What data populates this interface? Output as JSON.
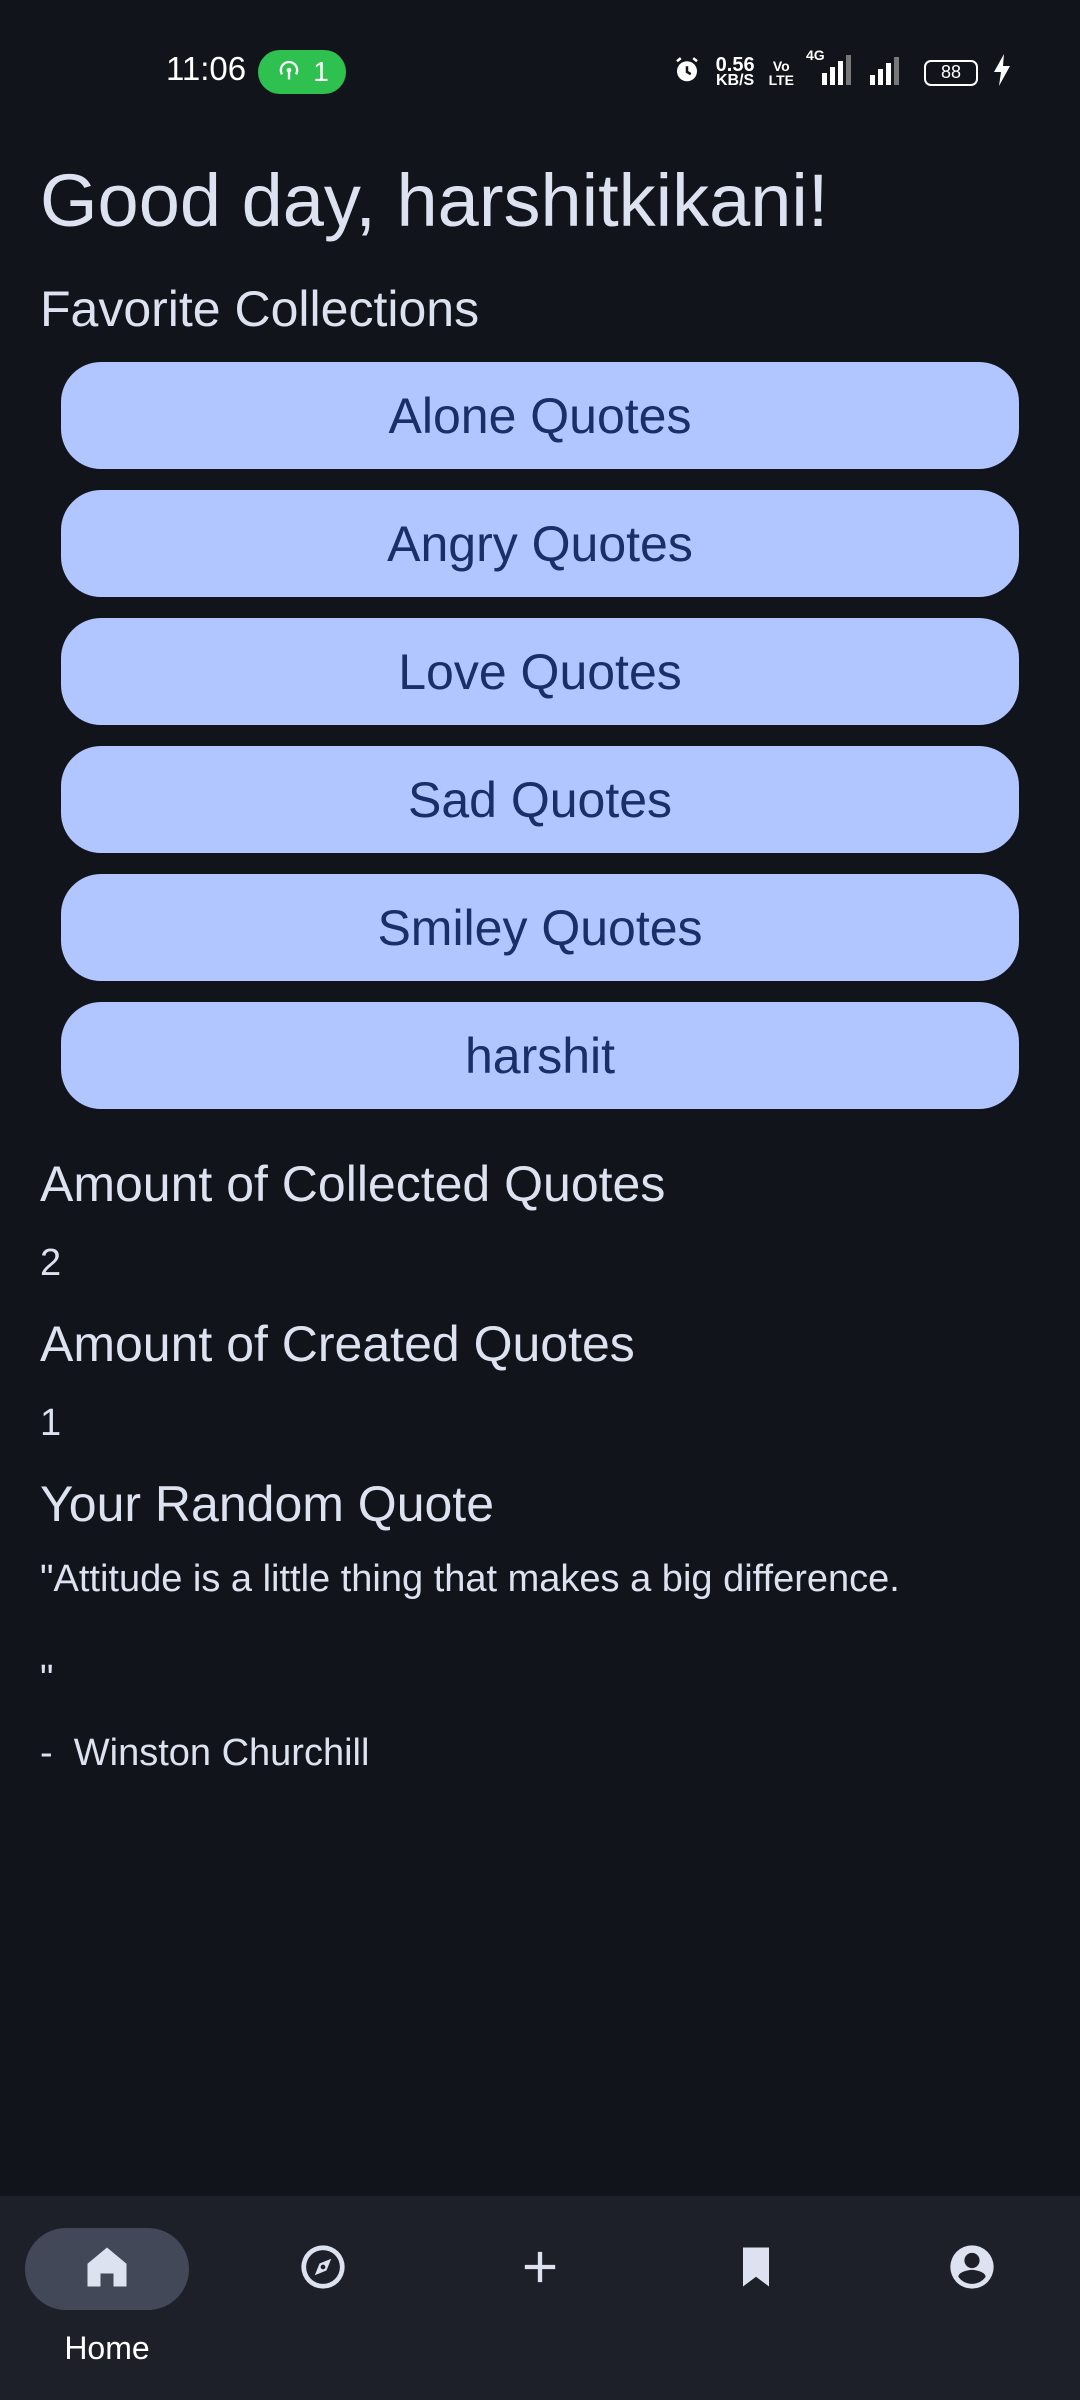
{
  "status_bar": {
    "time": "11:06",
    "hotspot_count": "1",
    "net_speed": "0.56",
    "net_speed_unit": "KB/S",
    "volte_top": "Vo",
    "volte_bottom": "LTE",
    "network": "4G",
    "battery": "88"
  },
  "greeting": "Good day, harshitkikani!",
  "favorites": {
    "title": "Favorite Collections",
    "items": [
      "Alone Quotes",
      "Angry Quotes",
      "Love Quotes",
      "Sad Quotes",
      "Smiley Quotes",
      "harshit"
    ]
  },
  "stats": {
    "collected_title": "Amount of Collected Quotes",
    "collected_value": "2",
    "created_title": "Amount of Created Quotes",
    "created_value": "1"
  },
  "random_quote": {
    "title": "Your Random Quote",
    "text": "\"Attitude is a little thing that makes a big difference.",
    "closing": "\"",
    "author": "-  Winston Churchill"
  },
  "bottom_nav": {
    "items": [
      {
        "label": "Home",
        "icon": "home-icon",
        "active": true
      },
      {
        "label": "",
        "icon": "compass-icon",
        "active": false
      },
      {
        "label": "",
        "icon": "plus-icon",
        "active": false
      },
      {
        "label": "",
        "icon": "bookmark-icon",
        "active": false
      },
      {
        "label": "",
        "icon": "account-icon",
        "active": false
      }
    ]
  },
  "colors": {
    "background": "#11141b",
    "button_bg": "#b1c6ff",
    "button_text": "#1a2f66",
    "nav_bg": "#1d2029",
    "nav_active": "#434859",
    "hotspot": "#2fc150"
  }
}
